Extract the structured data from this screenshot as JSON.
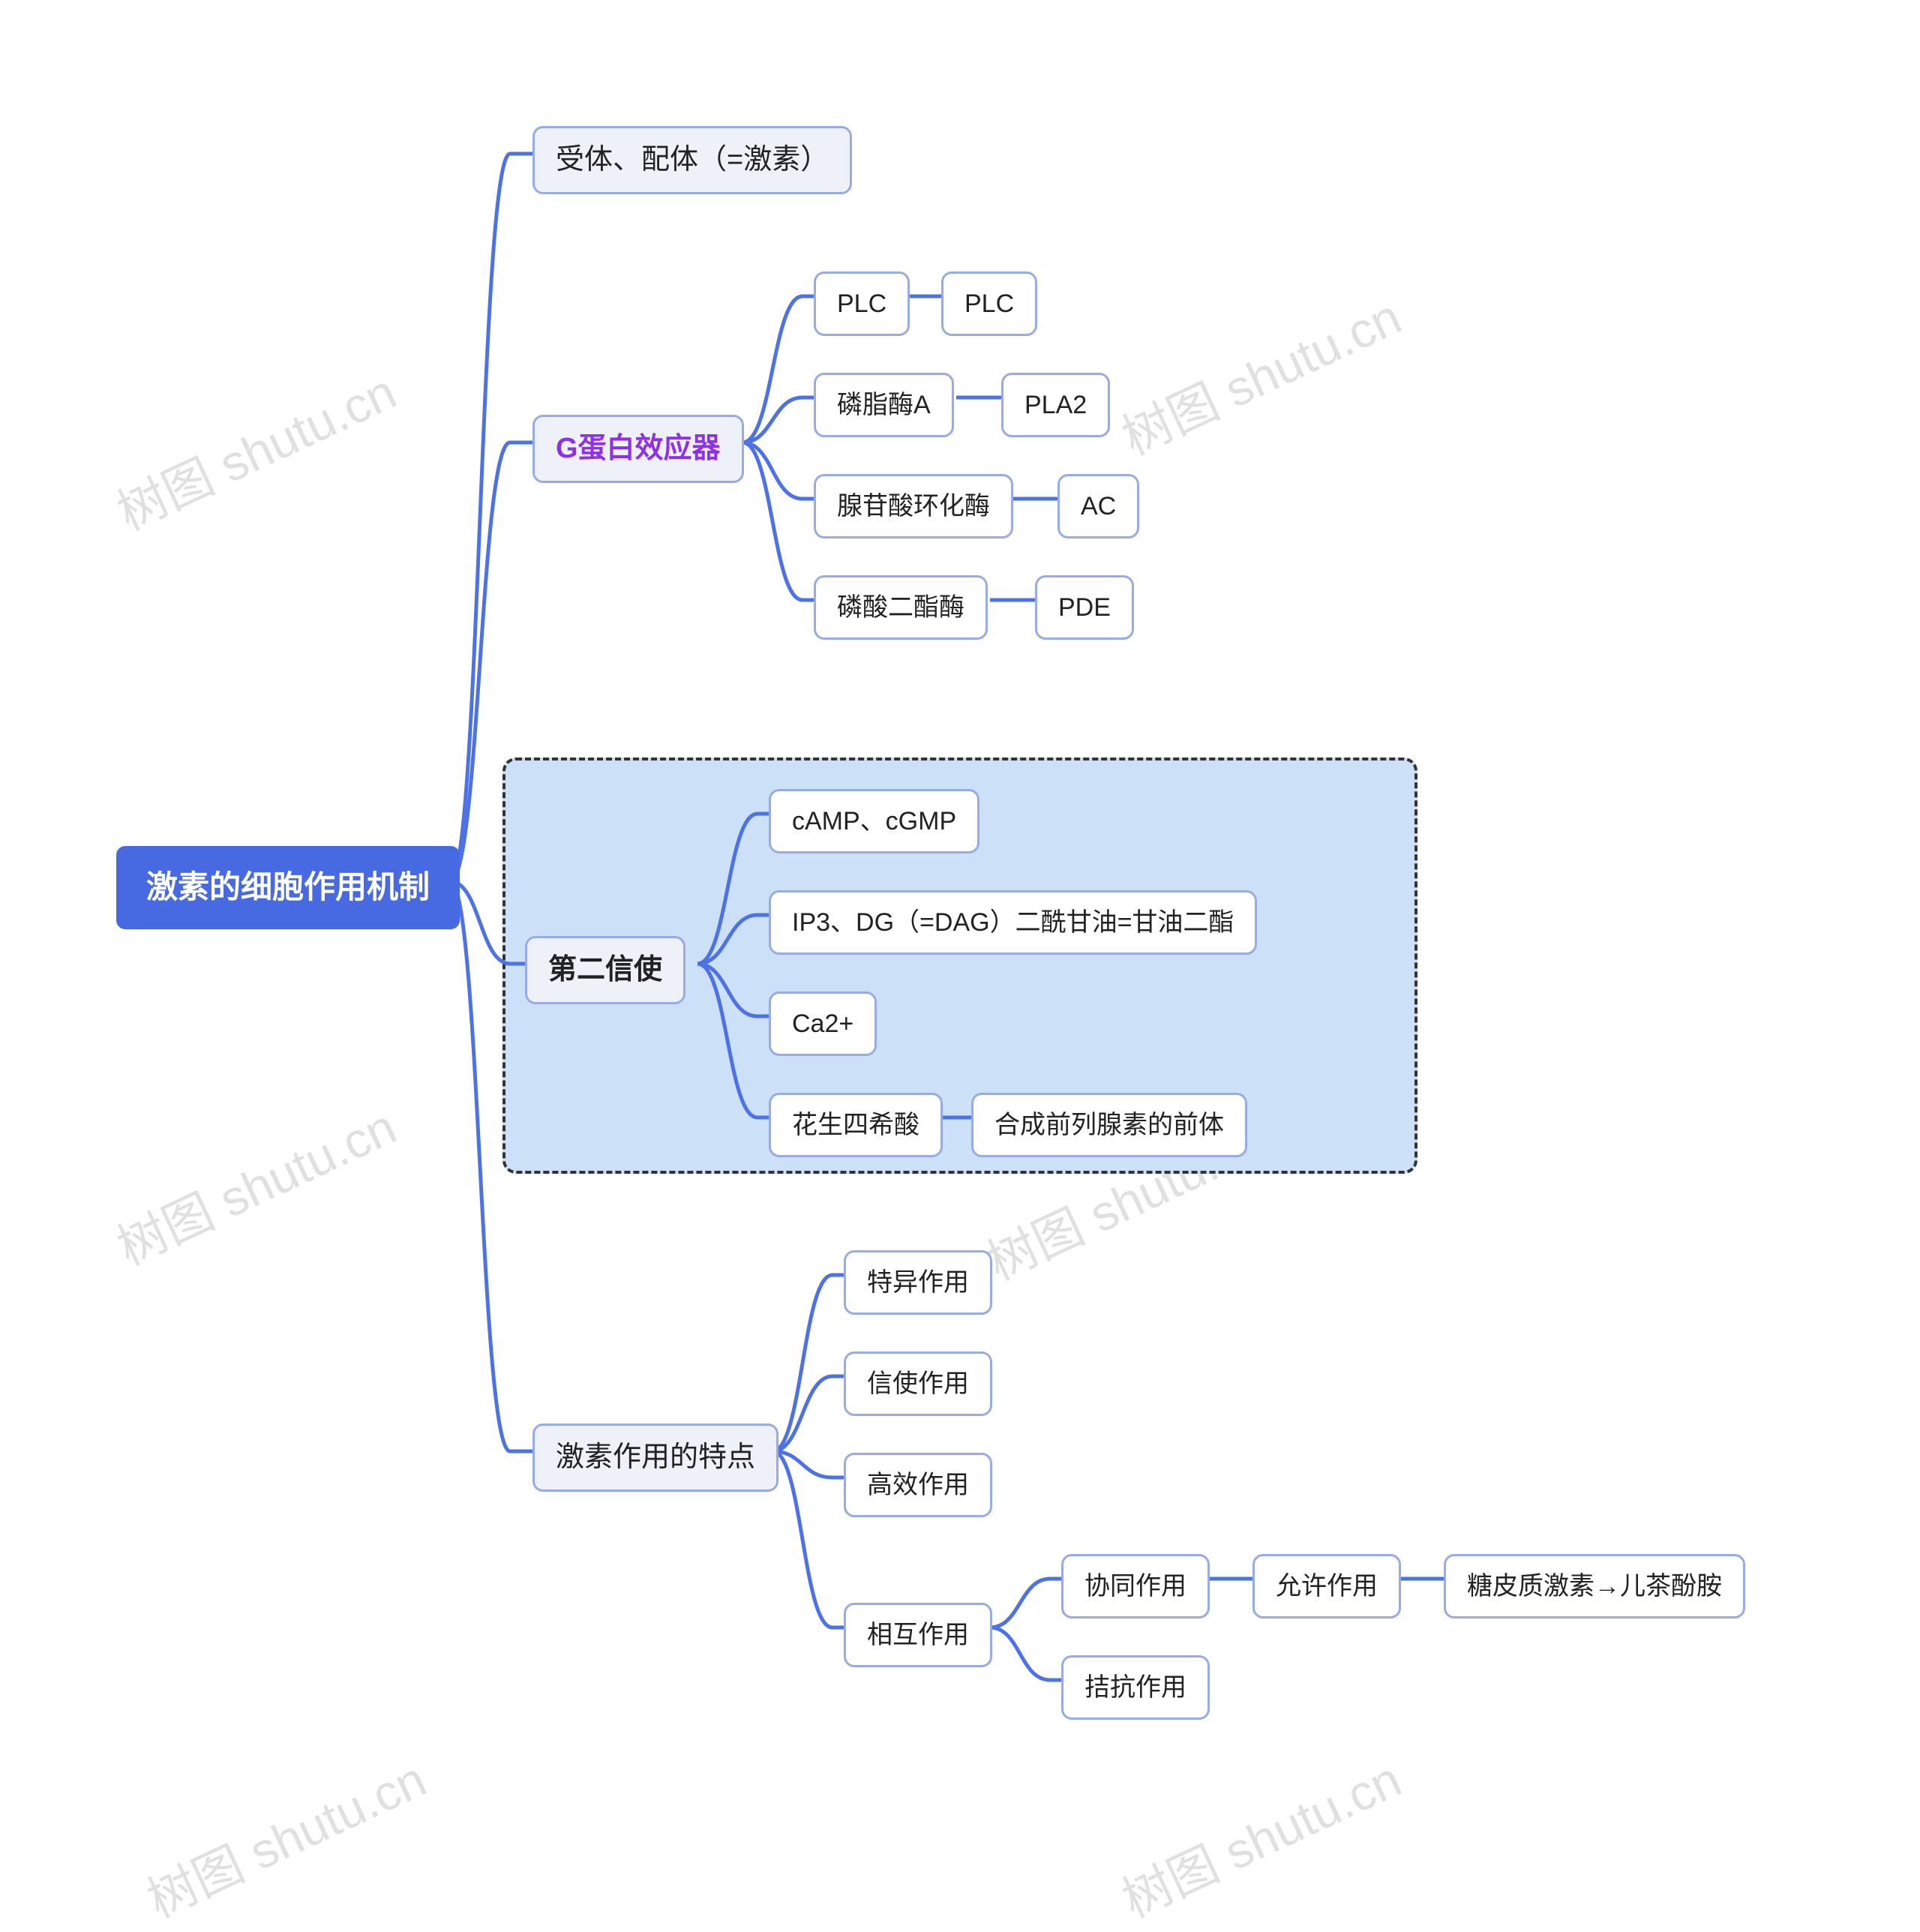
{
  "watermark": "树图 shutu.cn",
  "root": "激素的细胞作用机制",
  "branches": {
    "b1": {
      "label": "受体、配体（=激素）"
    },
    "b2": {
      "label": "G蛋白效应器",
      "children": {
        "c1": {
          "label": "PLC",
          "sub": "PLC"
        },
        "c2": {
          "label": "磷脂酶A",
          "sub": "PLA2"
        },
        "c3": {
          "label": "腺苷酸环化酶",
          "sub": "AC"
        },
        "c4": {
          "label": "磷酸二酯酶",
          "sub": "PDE"
        }
      }
    },
    "b3": {
      "label": "第二信使",
      "children": {
        "c1": {
          "label": "cAMP、cGMP"
        },
        "c2": {
          "label": "IP3、DG（=DAG）二酰甘油=甘油二酯"
        },
        "c3": {
          "label": "Ca2+"
        },
        "c4": {
          "label": "花生四希酸",
          "sub": "合成前列腺素的前体"
        }
      }
    },
    "b4": {
      "label": "激素作用的特点",
      "children": {
        "c1": {
          "label": "特异作用"
        },
        "c2": {
          "label": "信使作用"
        },
        "c3": {
          "label": "高效作用"
        },
        "c4": {
          "label": "相互作用",
          "sub1": {
            "label": "协同作用",
            "sub": {
              "label": "允许作用",
              "sub": "糖皮质激素→儿茶酚胺"
            }
          },
          "sub2": {
            "label": "拮抗作用"
          }
        }
      }
    }
  },
  "chart_data": {
    "type": "mindmap",
    "title": "激素的细胞作用机制",
    "root": "激素的细胞作用机制",
    "children": [
      {
        "label": "受体、配体（=激素）"
      },
      {
        "label": "G蛋白效应器",
        "highlight": "purple",
        "children": [
          {
            "label": "PLC",
            "children": [
              {
                "label": "PLC"
              }
            ]
          },
          {
            "label": "磷脂酶A",
            "children": [
              {
                "label": "PLA2"
              }
            ]
          },
          {
            "label": "腺苷酸环化酶",
            "children": [
              {
                "label": "AC"
              }
            ]
          },
          {
            "label": "磷酸二酯酶",
            "children": [
              {
                "label": "PDE"
              }
            ]
          }
        ]
      },
      {
        "label": "第二信使",
        "highlight": "boxed",
        "children": [
          {
            "label": "cAMP、cGMP"
          },
          {
            "label": "IP3、DG（=DAG）二酰甘油=甘油二酯"
          },
          {
            "label": "Ca2+"
          },
          {
            "label": "花生四希酸",
            "children": [
              {
                "label": "合成前列腺素的前体"
              }
            ]
          }
        ]
      },
      {
        "label": "激素作用的特点",
        "children": [
          {
            "label": "特异作用"
          },
          {
            "label": "信使作用"
          },
          {
            "label": "高效作用"
          },
          {
            "label": "相互作用",
            "children": [
              {
                "label": "协同作用",
                "children": [
                  {
                    "label": "允许作用",
                    "children": [
                      {
                        "label": "糖皮质激素→儿茶酚胺"
                      }
                    ]
                  }
                ]
              },
              {
                "label": "拮抗作用"
              }
            ]
          }
        ]
      }
    ]
  }
}
